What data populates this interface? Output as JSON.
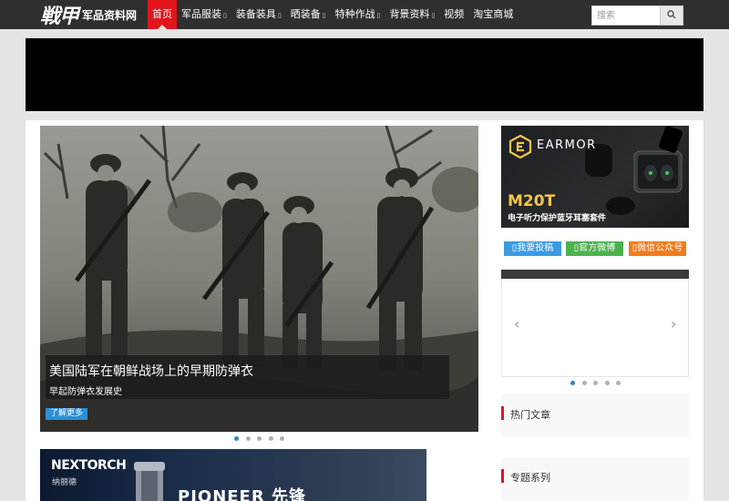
{
  "header": {
    "logo_glyph": "戦甲",
    "logo_text": "军品资料网",
    "menu": [
      {
        "label": "首页",
        "dropdown": false,
        "active": true
      },
      {
        "label": "军品服装",
        "dropdown": true
      },
      {
        "label": "装备装具",
        "dropdown": true
      },
      {
        "label": "晒装备",
        "dropdown": true
      },
      {
        "label": "特种作战",
        "dropdown": true
      },
      {
        "label": "背景资料",
        "dropdown": true
      },
      {
        "label": "视频",
        "dropdown": false
      },
      {
        "label": "淘宝商城",
        "dropdown": false
      }
    ],
    "dropdown_glyph": "▯",
    "search_placeholder": "搜索",
    "search_icon": "search-icon"
  },
  "slider": {
    "caption_title": "美国陆军在朝鲜战场上的早期防弹衣",
    "caption_subtitle": "早起防弹衣发展史",
    "more_label": "了解更多",
    "dot_count": 5,
    "active_dot": 0
  },
  "ad_nextorch": {
    "brand": "NEXTORCH",
    "brand_cn": "纳丽德",
    "product": "PIONEER 先锋"
  },
  "ad_earmor": {
    "brand": "EARMOR",
    "model": "M20T",
    "description": "电子听力保护蓝牙耳塞套件"
  },
  "social": {
    "submit_label": "我要投稿",
    "weibo_label": "官方微博",
    "wechat_label": "微信公众号",
    "glyph": "▯"
  },
  "widget": {
    "prev_arrow": "‹",
    "next_arrow": "›",
    "dot_count": 5,
    "active_dot": 0
  },
  "sidebar": {
    "hot_articles_title": "热门文章",
    "topics_title": "专题系列"
  },
  "colors": {
    "nav_bg": "#2f2f2f",
    "active_red": "#e0161b",
    "more_blue": "#2d8fd5",
    "social_blue": "#3c9ade",
    "social_green": "#4db24d",
    "social_orange": "#f07c1e",
    "earmor_gold": "#f7c64a"
  }
}
